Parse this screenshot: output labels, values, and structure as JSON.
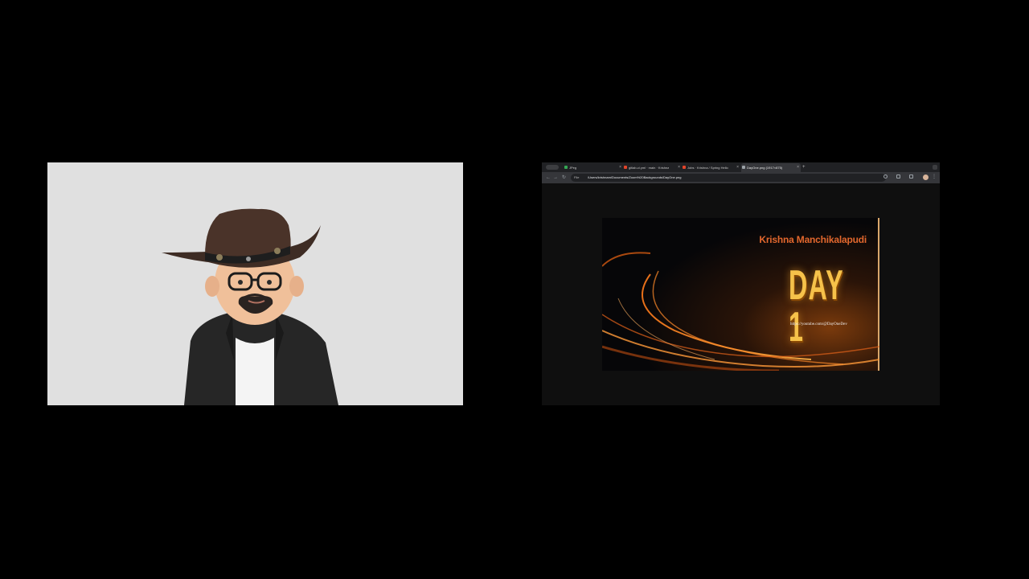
{
  "browser": {
    "tabs": [
      {
        "title": "JPeg",
        "favicon_color": "#34a853",
        "active": false
      },
      {
        "title": "gitlab-ci.yml · main · Krishna",
        "favicon_color": "#e24329",
        "active": false
      },
      {
        "title": "Jobs · Krishna / Spring Hello",
        "favicon_color": "#e24329",
        "active": false
      },
      {
        "title": "DayOne.png (1917×875)",
        "favicon_color": "#9aa0a6",
        "active": true
      }
    ],
    "new_tab_label": "+",
    "tab_close_glyph": "×",
    "address_scheme": "File",
    "address_url": "/Users/krishnam/Documents/Zoom%20Backgrounds/DayOne.png",
    "back_glyph": "←",
    "forward_glyph": "→",
    "reload_glyph": "↻",
    "menu_glyph": "⋮"
  },
  "shared_image": {
    "name": "Krishna Manchikalapudi",
    "headline": "DAY 1",
    "link": "https://youtube.com/@DayOneDev",
    "name_color": "#e2672d",
    "headline_color": "#f6c24a"
  }
}
